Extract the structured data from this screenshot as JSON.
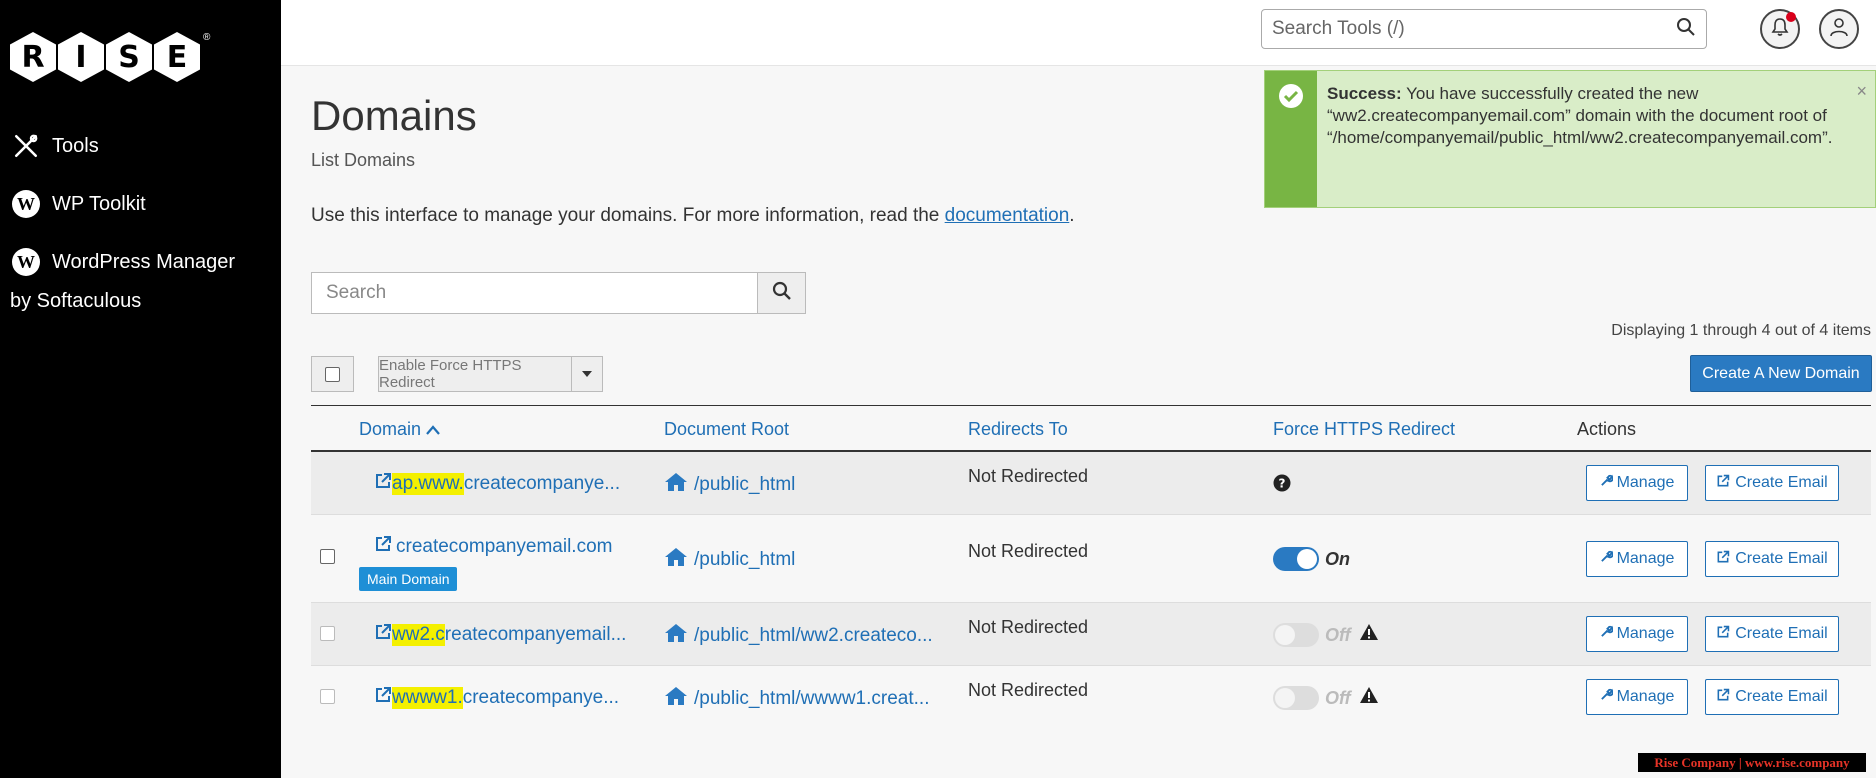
{
  "sidebar": {
    "logo_letters": [
      "R",
      "I",
      "S",
      "E"
    ],
    "logo_mark": "®",
    "items": [
      {
        "label": "Tools",
        "icon": "tools-icon"
      },
      {
        "label": "WP Toolkit",
        "icon": "wordpress-icon"
      },
      {
        "label": "WordPress Manager",
        "icon": "wordpress-icon"
      }
    ],
    "sub_label": "by Softaculous"
  },
  "topbar": {
    "search_placeholder": "Search Tools (/)"
  },
  "page": {
    "title": "Domains",
    "subtitle": "List Domains",
    "intro_text": "Use this interface to manage your domains. For more information, read the ",
    "intro_link": "documentation",
    "intro_end": ".",
    "search_placeholder": "Search",
    "displaying": "Displaying 1 through 4 out of 4 items",
    "bulk_action": "Enable Force HTTPS Redirect",
    "create_button": "Create A New Domain"
  },
  "alert": {
    "strong": "Success:",
    "message": " You have successfully created the new “ww2.createcompanyemail.com” domain with the document root of “/home/companyemail/public_html/ww2.createcompanyemail.com”.",
    "close": "×"
  },
  "table": {
    "headers": {
      "domain": "Domain",
      "document_root": "Document Root",
      "redirects_to": "Redirects To",
      "force_https": "Force HTTPS Redirect",
      "actions": "Actions"
    },
    "rows": [
      {
        "domain_hl": "ap.www.",
        "domain_rest": "createcompanye...",
        "docroot": "/public_html",
        "redirect": "Not Redirected",
        "https": "unknown",
        "https_label": ""
      },
      {
        "domain_hl": "",
        "domain_rest": "createcompanyemail.com",
        "badge": "Main Domain",
        "docroot": "/public_html",
        "redirect": "Not Redirected",
        "https": "on",
        "https_label": "On"
      },
      {
        "domain_hl": "ww2.c",
        "domain_rest": "reatecompanyemail...",
        "docroot": "/public_html/ww2.createco...",
        "redirect": "Not Redirected",
        "https": "off",
        "https_label": "Off"
      },
      {
        "domain_hl": "wwww1.",
        "domain_rest": "createcompanye...",
        "docroot": "/public_html/wwww1.creat...",
        "redirect": "Not Redirected",
        "https": "off",
        "https_label": "Off"
      }
    ],
    "manage_label": "Manage",
    "create_email_label": "Create Email"
  },
  "watermark": "Rise Company | www.rise.company"
}
